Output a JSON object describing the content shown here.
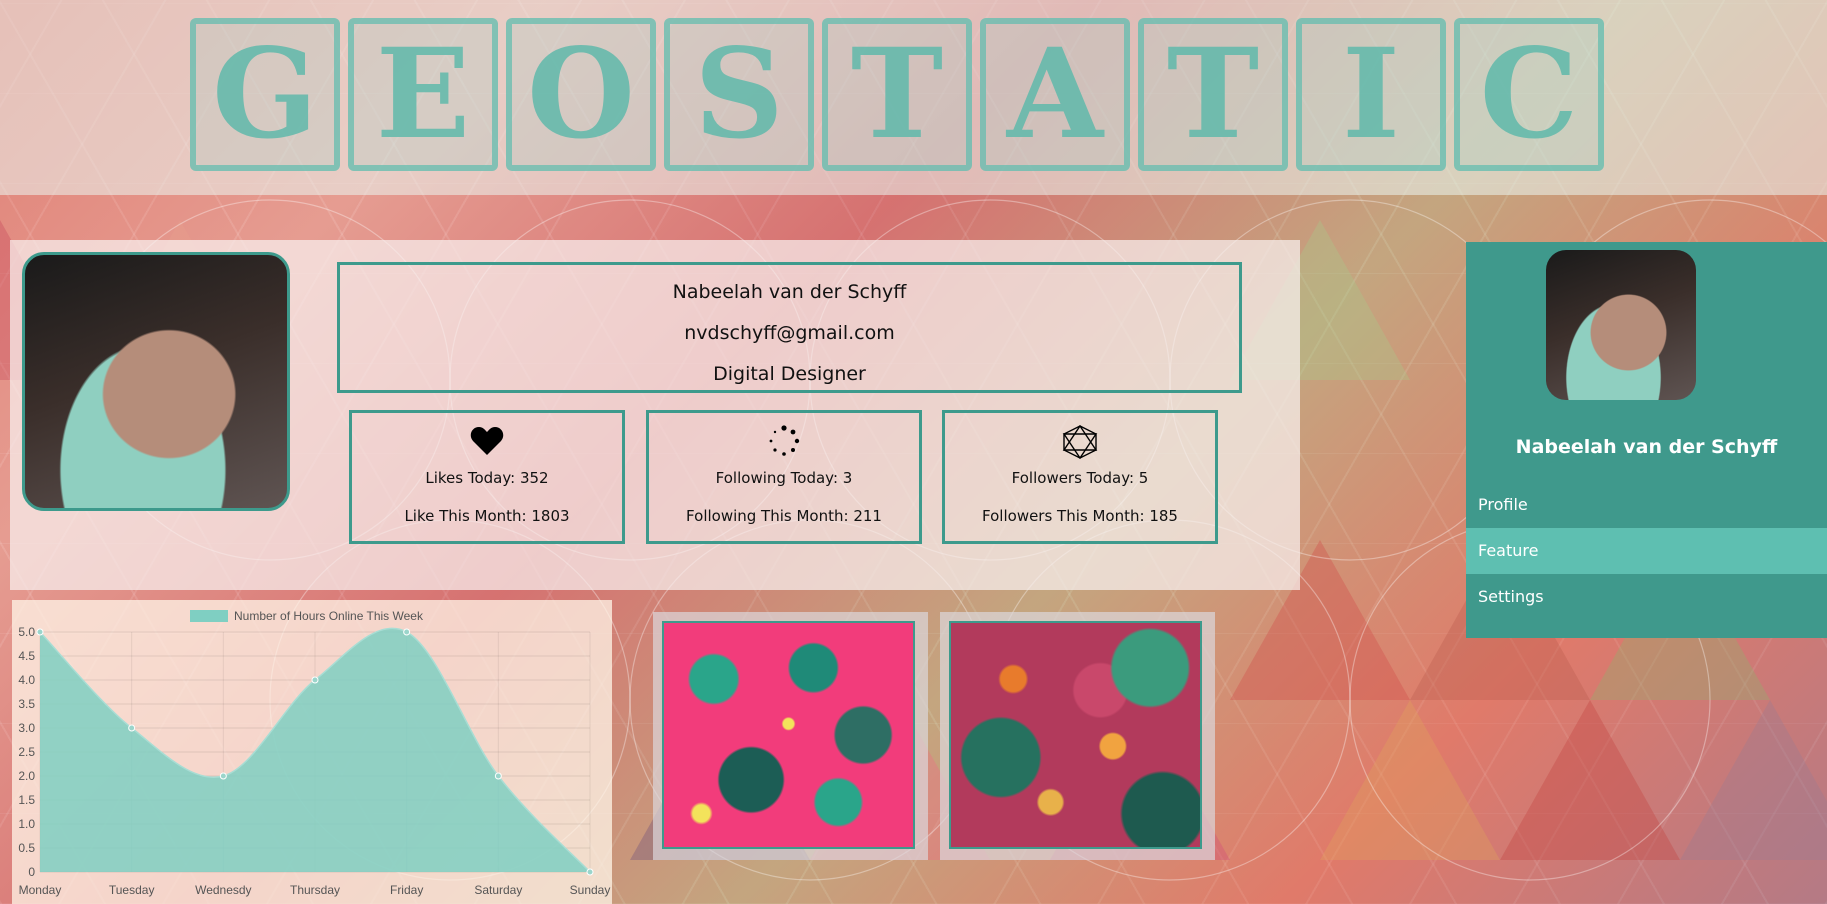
{
  "logo": {
    "letters": [
      "G",
      "E",
      "O",
      "S",
      "T",
      "A",
      "T",
      "I",
      "C"
    ]
  },
  "profile": {
    "name": "Nabeelah van der Schyff",
    "email": "nvdschyff@gmail.com",
    "title": "Digital Designer"
  },
  "stats": [
    {
      "icon": "heart-icon",
      "today": "Likes Today: 352",
      "month": "Like This Month: 1803"
    },
    {
      "icon": "loading-dots-icon",
      "today": "Following Today: 3",
      "month": "Following This Month: 211"
    },
    {
      "icon": "geometric-icon",
      "today": "Followers Today: 5",
      "month": "Followers This Month: 185"
    }
  ],
  "sidebar": {
    "name": "Nabeelah van der Schyff",
    "items": [
      {
        "label": "Profile",
        "active": false
      },
      {
        "label": "Feature",
        "active": true
      },
      {
        "label": "Settings",
        "active": false
      }
    ]
  },
  "colors": {
    "accent": "#3f998c",
    "accent_light": "#5ebfb1",
    "chart_fill": "#7fcfc2"
  },
  "chart_data": {
    "type": "area",
    "categories": [
      "Monday",
      "Tuesday",
      "Wednesdy",
      "Thursday",
      "Friday",
      "Saturday",
      "Sunday"
    ],
    "series": [
      {
        "name": "Number of Hours Online This Week",
        "values": [
          5,
          3,
          2,
          4,
          5,
          2,
          0
        ]
      }
    ],
    "y_ticks": [
      "0",
      "0.5",
      "1.0",
      "1.5",
      "2.0",
      "2.5",
      "3.0",
      "3.5",
      "4.0",
      "4.5",
      "5.0"
    ],
    "ylim": [
      0,
      5
    ],
    "legend": "top-center",
    "grid": true
  }
}
